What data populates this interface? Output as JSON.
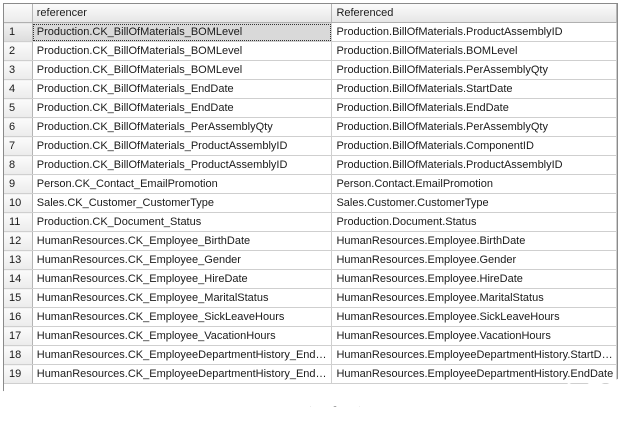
{
  "columns": [
    "referencer",
    "Referenced"
  ],
  "rows": [
    {
      "n": "1",
      "referencer": "Production.CK_BillOfMaterials_BOMLevel",
      "referenced": "Production.BillOfMaterials.ProductAssemblyID"
    },
    {
      "n": "2",
      "referencer": "Production.CK_BillOfMaterials_BOMLevel",
      "referenced": "Production.BillOfMaterials.BOMLevel"
    },
    {
      "n": "3",
      "referencer": "Production.CK_BillOfMaterials_BOMLevel",
      "referenced": "Production.BillOfMaterials.PerAssemblyQty"
    },
    {
      "n": "4",
      "referencer": "Production.CK_BillOfMaterials_EndDate",
      "referenced": "Production.BillOfMaterials.StartDate"
    },
    {
      "n": "5",
      "referencer": "Production.CK_BillOfMaterials_EndDate",
      "referenced": "Production.BillOfMaterials.EndDate"
    },
    {
      "n": "6",
      "referencer": "Production.CK_BillOfMaterials_PerAssemblyQty",
      "referenced": "Production.BillOfMaterials.PerAssemblyQty"
    },
    {
      "n": "7",
      "referencer": "Production.CK_BillOfMaterials_ProductAssemblyID",
      "referenced": "Production.BillOfMaterials.ComponentID"
    },
    {
      "n": "8",
      "referencer": "Production.CK_BillOfMaterials_ProductAssemblyID",
      "referenced": "Production.BillOfMaterials.ProductAssemblyID"
    },
    {
      "n": "9",
      "referencer": "Person.CK_Contact_EmailPromotion",
      "referenced": "Person.Contact.EmailPromotion"
    },
    {
      "n": "10",
      "referencer": "Sales.CK_Customer_CustomerType",
      "referenced": "Sales.Customer.CustomerType"
    },
    {
      "n": "11",
      "referencer": "Production.CK_Document_Status",
      "referenced": "Production.Document.Status"
    },
    {
      "n": "12",
      "referencer": "HumanResources.CK_Employee_BirthDate",
      "referenced": "HumanResources.Employee.BirthDate"
    },
    {
      "n": "13",
      "referencer": "HumanResources.CK_Employee_Gender",
      "referenced": "HumanResources.Employee.Gender"
    },
    {
      "n": "14",
      "referencer": "HumanResources.CK_Employee_HireDate",
      "referenced": "HumanResources.Employee.HireDate"
    },
    {
      "n": "15",
      "referencer": "HumanResources.CK_Employee_MaritalStatus",
      "referenced": "HumanResources.Employee.MaritalStatus"
    },
    {
      "n": "16",
      "referencer": "HumanResources.CK_Employee_SickLeaveHours",
      "referenced": "HumanResources.Employee.SickLeaveHours"
    },
    {
      "n": "17",
      "referencer": "HumanResources.CK_Employee_VacationHours",
      "referenced": "HumanResources.Employee.VacationHours"
    },
    {
      "n": "18",
      "referencer": "HumanResources.CK_EmployeeDepartmentHistory_EndD...",
      "referenced": "HumanResources.EmployeeDepartmentHistory.StartDate"
    },
    {
      "n": "19",
      "referencer": "HumanResources.CK_EmployeeDepartmentHistory_EndD...",
      "referenced": "HumanResources.EmployeeDepartmentHistory.EndDate"
    }
  ],
  "selected_row": 0
}
